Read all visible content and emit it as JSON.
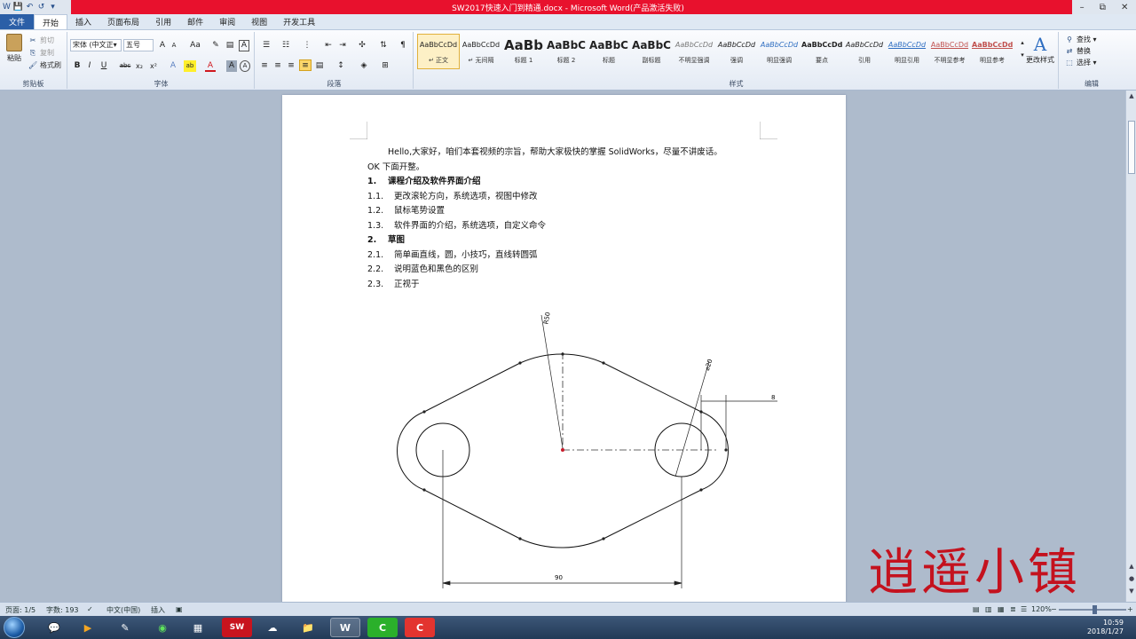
{
  "window": {
    "title": "SW2017快速入门到精通.docx - Microsoft Word(产品激活失败)",
    "qat": [
      "W",
      "💾",
      "↶",
      "↺",
      "▾"
    ],
    "controls": [
      "–",
      "⧉",
      "✕"
    ]
  },
  "tabs": [
    {
      "label": "文件"
    },
    {
      "label": "开始"
    },
    {
      "label": "插入"
    },
    {
      "label": "页面布局"
    },
    {
      "label": "引用"
    },
    {
      "label": "邮件"
    },
    {
      "label": "审阅"
    },
    {
      "label": "视图"
    },
    {
      "label": "开发工具"
    }
  ],
  "ribbon": {
    "clipboard": {
      "paste": "粘贴",
      "cut": "剪切",
      "copy": "复制",
      "format_painter": "格式刷",
      "label": "剪贴板"
    },
    "font": {
      "family": "宋体 (中文正▾",
      "size": "五号",
      "grow": "A",
      "shrink": "A",
      "case": "Aa",
      "label": "字体",
      "buttons": [
        "B",
        "I",
        "U",
        "abc",
        "x₂",
        "x²",
        "A",
        "ab",
        "A",
        "A",
        "A"
      ]
    },
    "paragraph": {
      "label": "段落"
    },
    "styles": {
      "label": "样式",
      "items": [
        {
          "sample": "AaBbCcDd",
          "name": "↵ 正文"
        },
        {
          "sample": "AaBbCcDd",
          "name": "↵ 无间隔"
        },
        {
          "sample": "AaBb",
          "name": "标题 1"
        },
        {
          "sample": "AaBbC",
          "name": "标题 2"
        },
        {
          "sample": "AaBbC",
          "name": "标题"
        },
        {
          "sample": "AaBbC",
          "name": "副标题"
        },
        {
          "sample": "AaBbCcDd",
          "name": "不明显强调"
        },
        {
          "sample": "AaBbCcDd",
          "name": "强调"
        },
        {
          "sample": "AaBbCcDd",
          "name": "明显强调"
        },
        {
          "sample": "AaBbCcDd",
          "name": "要点"
        },
        {
          "sample": "AaBbCcDd",
          "name": "引用"
        },
        {
          "sample": "AaBbCcDd",
          "name": "明显引用"
        },
        {
          "sample": "AaBbCcDd",
          "name": "不明显参考"
        },
        {
          "sample": "AaBbCcDd",
          "name": "明显参考"
        }
      ],
      "change": "更改样式"
    },
    "editing": {
      "find": "查找 ▾",
      "replace": "替换",
      "select": "选择 ▾",
      "label": "编辑"
    }
  },
  "document": {
    "intro": "Hello,大家好，咱们本套视频的宗旨，帮助大家极快的掌握 SolidWorks，尽量不讲废话。",
    "intro2": "OK 下面开整。",
    "sections": [
      {
        "num": "1.",
        "title": "课程介绍及软件界面介绍",
        "items": [
          {
            "num": "1.1.",
            "text": "更改滚轮方向，系统选项，视图中修改"
          },
          {
            "num": "1.2.",
            "text": "鼠标笔势设置"
          },
          {
            "num": "1.3.",
            "text": "软件界面的介绍，系统选项，自定义命令"
          }
        ]
      },
      {
        "num": "2.",
        "title": "草图",
        "items": [
          {
            "num": "2.1.",
            "text": "简单画直线，圆，小技巧，直线转圆弧"
          },
          {
            "num": "2.2.",
            "text": "说明蓝色和黑色的区别"
          },
          {
            "num": "2.3.",
            "text": "正视于"
          }
        ]
      }
    ],
    "drawing": {
      "dim_r": "R50",
      "dim_dia": "⌀20",
      "dim_8": "8",
      "dim_90": "90"
    }
  },
  "statusbar": {
    "page": "页面: 1/5",
    "words": "字数: 193",
    "lang": "中文(中国)",
    "mode": "插入",
    "zoom": "120%"
  },
  "taskbar": {
    "items": [
      "💬",
      "▶",
      "✎",
      "◉",
      "▦",
      "SW",
      "☁",
      "📁",
      "W",
      "C",
      "C"
    ],
    "time": "10:59",
    "date": "2018/1/27"
  },
  "watermark": "逍遥小镇",
  "colors": {
    "title_red": "#e8112d",
    "file_tab": "#2b5fa7",
    "watermark": "#c4121e"
  }
}
